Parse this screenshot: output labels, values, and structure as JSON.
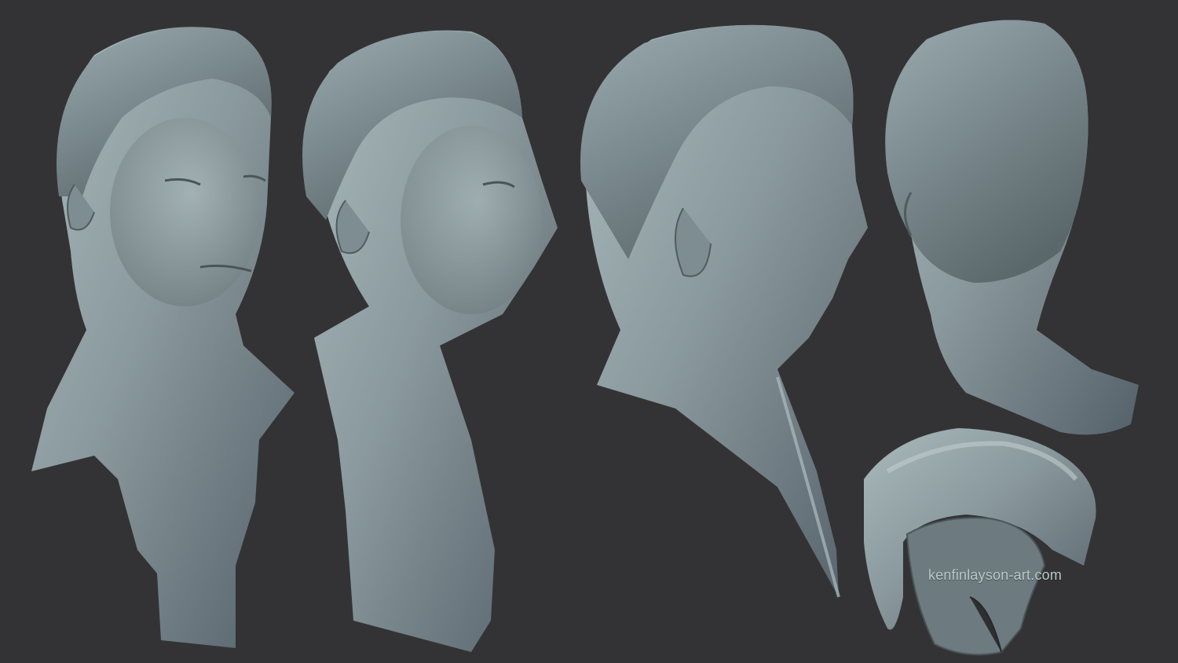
{
  "watermark": {
    "text": "kenfinlayson-art.com"
  },
  "colors": {
    "background": "#333335",
    "clay_light": "#9fb0b4",
    "clay_mid": "#7b8a8e",
    "clay_dark": "#4d585b"
  },
  "views": [
    {
      "id": "three-quarter-front"
    },
    {
      "id": "three-quarter-side"
    },
    {
      "id": "right-profile"
    },
    {
      "id": "back"
    },
    {
      "id": "teeth-and-tongue"
    }
  ]
}
